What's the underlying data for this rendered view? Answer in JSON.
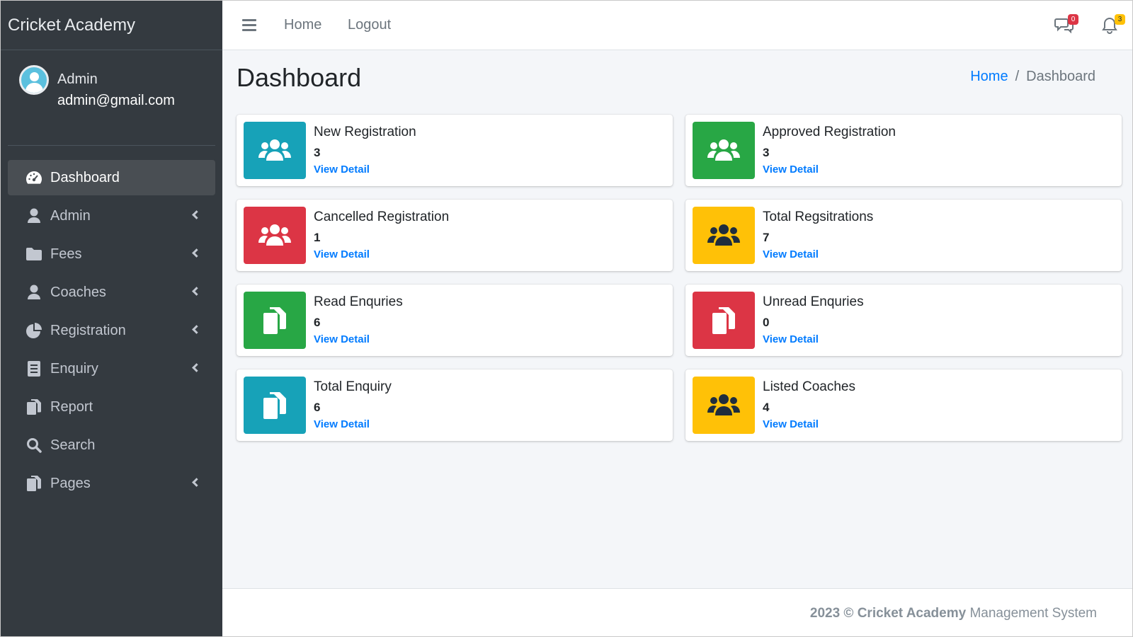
{
  "brand": "Cricket Academy",
  "user": {
    "name": "Admin",
    "email": "admin@gmail.com"
  },
  "sidebar": {
    "items": [
      {
        "label": "Dashboard",
        "icon": "tachometer-icon",
        "active": true,
        "has_submenu": false
      },
      {
        "label": "Admin",
        "icon": "user-icon",
        "has_submenu": true
      },
      {
        "label": "Fees",
        "icon": "folder-icon",
        "has_submenu": true
      },
      {
        "label": "Coaches",
        "icon": "user-icon",
        "has_submenu": true
      },
      {
        "label": "Registration",
        "icon": "pie-chart-icon",
        "has_submenu": true
      },
      {
        "label": "Enquiry",
        "icon": "book-icon",
        "has_submenu": true
      },
      {
        "label": "Report",
        "icon": "copy-icon",
        "has_submenu": false
      },
      {
        "label": "Search",
        "icon": "search-icon",
        "has_submenu": false
      },
      {
        "label": "Pages",
        "icon": "copy-icon",
        "has_submenu": true
      }
    ]
  },
  "topbar": {
    "links": [
      "Home",
      "Logout"
    ],
    "messages_badge": "0",
    "notifications_badge": "3"
  },
  "page": {
    "title": "Dashboard",
    "breadcrumb": {
      "home": "Home",
      "separator": "/",
      "current": "Dashboard"
    }
  },
  "cards": [
    {
      "title": "New Registration",
      "value": "3",
      "link": "View Detail",
      "color": "#17a2b8",
      "icon": "users-icon"
    },
    {
      "title": "Approved Registration",
      "value": "3",
      "link": "View Detail",
      "color": "#28a745",
      "icon": "users-icon"
    },
    {
      "title": "Cancelled Registration",
      "value": "1",
      "link": "View Detail",
      "color": "#dc3545",
      "icon": "users-icon"
    },
    {
      "title": "Total Regsitrations",
      "value": "7",
      "link": "View Detail",
      "color": "#ffc107",
      "icon": "users-icon"
    },
    {
      "title": "Read Enquries",
      "value": "6",
      "link": "View Detail",
      "color": "#28a745",
      "icon": "copy-icon"
    },
    {
      "title": "Unread Enquries",
      "value": "0",
      "link": "View Detail",
      "color": "#dc3545",
      "icon": "copy-icon"
    },
    {
      "title": "Total Enquiry",
      "value": "6",
      "link": "View Detail",
      "color": "#17a2b8",
      "icon": "copy-icon"
    },
    {
      "title": "Listed Coaches",
      "value": "4",
      "link": "View Detail",
      "color": "#ffc107",
      "icon": "users-icon"
    }
  ],
  "footer": {
    "year": "2023 ©",
    "brand": "Cricket Academy",
    "suffix": "Management System"
  }
}
